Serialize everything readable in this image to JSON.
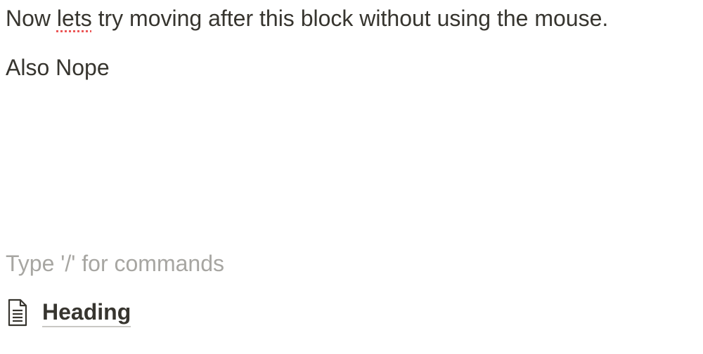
{
  "editor": {
    "blocks": [
      {
        "before": "Now ",
        "misspelled": "lets",
        "after": " try moving after this block without using the mouse."
      },
      {
        "text": "Also Nope"
      },
      {
        "placeholder": "Type '/' for commands"
      }
    ],
    "page_link": {
      "icon": "page-icon",
      "title": "Heading"
    }
  }
}
